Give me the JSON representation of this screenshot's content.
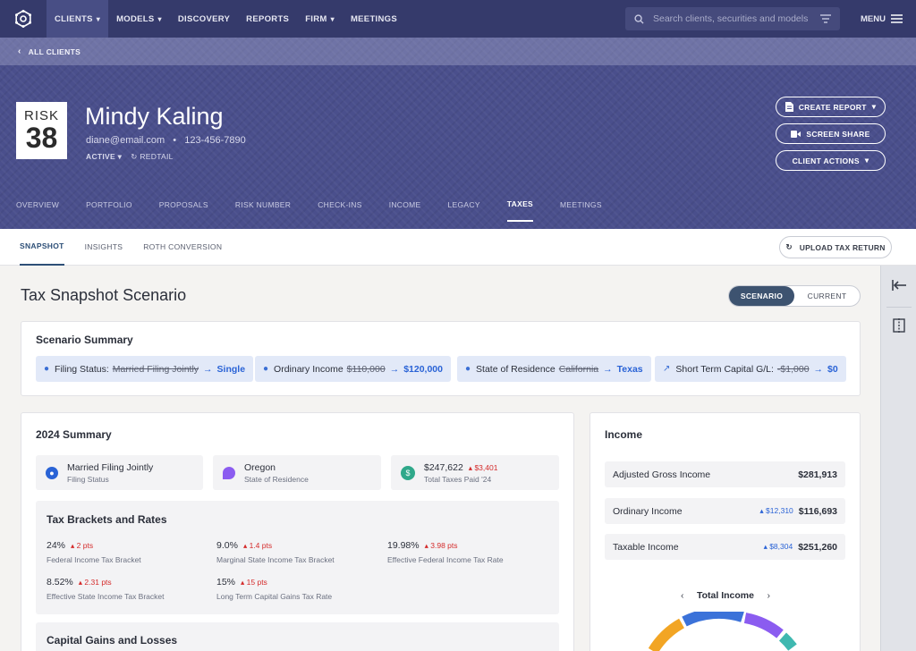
{
  "nav": {
    "items": [
      {
        "label": "CLIENTS",
        "active": true,
        "chevron": true
      },
      {
        "label": "MODELS",
        "active": false,
        "chevron": true
      },
      {
        "label": "DISCOVERY",
        "active": false,
        "chevron": false
      },
      {
        "label": "REPORTS",
        "active": false,
        "chevron": false
      },
      {
        "label": "FIRM",
        "active": false,
        "chevron": true
      },
      {
        "label": "MEETINGS",
        "active": false,
        "chevron": false
      }
    ],
    "search_placeholder": "Search clients, securities and models",
    "menu_label": "MENU"
  },
  "breadcrumb": {
    "label": "ALL CLIENTS"
  },
  "client": {
    "risk_label": "RISK",
    "risk_number": "38",
    "name": "Mindy Kaling",
    "email": "diane@email.com",
    "phone": "123-456-7890",
    "status": "ACTIVE",
    "crm": "REDTAIL"
  },
  "actions": {
    "create_report": "CREATE REPORT",
    "screen_share": "SCREEN SHARE",
    "client_actions": "CLIENT ACTIONS"
  },
  "client_tabs": [
    {
      "label": "OVERVIEW",
      "active": false
    },
    {
      "label": "PORTFOLIO",
      "active": false
    },
    {
      "label": "PROPOSALS",
      "active": false
    },
    {
      "label": "RISK NUMBER",
      "active": false
    },
    {
      "label": "CHECK-INS",
      "active": false
    },
    {
      "label": "INCOME",
      "active": false
    },
    {
      "label": "LEGACY",
      "active": false
    },
    {
      "label": "TAXES",
      "active": true
    },
    {
      "label": "MEETINGS",
      "active": false
    }
  ],
  "tax_tabs": [
    {
      "label": "SNAPSHOT",
      "active": true
    },
    {
      "label": "INSIGHTS",
      "active": false
    },
    {
      "label": "ROTH CONVERSION",
      "active": false
    }
  ],
  "upload_label": "UPLOAD TAX RETURN",
  "page": {
    "title": "Tax Snapshot Scenario",
    "toggle": {
      "scenario": "SCENARIO",
      "current": "CURRENT",
      "selected": "SCENARIO"
    }
  },
  "scenario_summary": {
    "title": "Scenario Summary",
    "chips": [
      {
        "icon": "person-icon",
        "label": "Filing Status:",
        "old": "Married Filing Jointly",
        "new": "Single"
      },
      {
        "icon": "dollar-icon",
        "label": "Ordinary Income",
        "old": "$110,000",
        "new": "$120,000"
      },
      {
        "icon": "location-icon",
        "label": "State of Residence",
        "old": "California",
        "new": "Texas"
      },
      {
        "icon": "trend-icon",
        "label": "Short Term Capital G/L:",
        "old": "-$1,000",
        "new": "$0"
      }
    ]
  },
  "summary_2024": {
    "title": "2024 Summary",
    "filing": {
      "value": "Married Filing Jointly",
      "label": "Filing Status"
    },
    "state": {
      "value": "Oregon",
      "label": "State of Residence"
    },
    "taxes": {
      "value": "$247,622",
      "delta": "$3,401",
      "label": "Total Taxes Paid '24"
    },
    "brackets": {
      "title": "Tax Brackets and Rates",
      "rates": [
        {
          "value": "24%",
          "delta": "2 pts",
          "label": "Federal Income Tax Bracket"
        },
        {
          "value": "9.0%",
          "delta": "1.4 pts",
          "label": "Marginal State Income Tax Bracket"
        },
        {
          "value": "19.98%",
          "delta": "3.98 pts",
          "label": "Effective Federal Income Tax Rate"
        },
        {
          "value": "8.52%",
          "delta": "2.31 pts",
          "label": "Effective State Income Tax Bracket"
        },
        {
          "value": "15%",
          "delta": "15 pts",
          "label": "Long Term Capital Gains Tax Rate"
        }
      ]
    },
    "capital_gains_title": "Capital Gains and Losses"
  },
  "income": {
    "title": "Income",
    "rows": [
      {
        "label": "Adjusted Gross Income",
        "delta": "",
        "value": "$281,913"
      },
      {
        "label": "Ordinary Income",
        "delta": "$12,310",
        "value": "$116,693"
      },
      {
        "label": "Taxable Income",
        "delta": "$8,304",
        "value": "$251,260"
      }
    ],
    "chart_title": "Total Income",
    "donut_colors": [
      "#f2a524",
      "#3b72d9",
      "#8b5cf0",
      "#3fb8b0"
    ]
  },
  "colors": {
    "nav_bg": "#353a6b",
    "hero_bg": "#4a4f8c",
    "accent_blue": "#2a63d6",
    "increase_red": "#d42b2b"
  }
}
